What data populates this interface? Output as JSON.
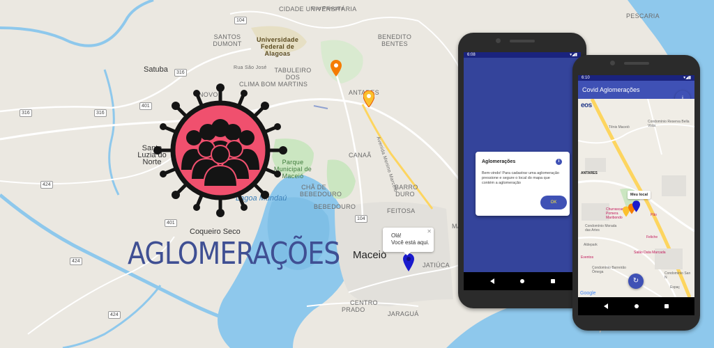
{
  "app": {
    "title": "AGLOMERAÇÕES",
    "colors": {
      "primary": "#3f51b5",
      "logo_red": "#f0506e",
      "logo_outline": "#141414",
      "title_blue": "#3f4f93",
      "accent_yellow": "#ffeb3b"
    }
  },
  "map": {
    "labels": {
      "cidade_universitaria": "CIDADE UNIVERSITÁRIA",
      "santos_dumont": "SANTOS DUMONT",
      "ufal": "Universidade Federal de Alagoas",
      "benedito_bentes": "BENEDITO BENTES",
      "satuba": "Satuba",
      "tabuleiro": "TABULEIRO DOS MARTINS",
      "clima_bom": "CLIMA BOM",
      "novo": "NOVO",
      "santa_luzia": "Santa Luzia do Norte",
      "parque": "Parque Municipal de Maceió",
      "canaa": "CANAÃ",
      "barro_duro": "BARRO DURO",
      "cha_bebedouro": "CHÃ DE BEBEDOURO",
      "bebedouro": "BEBEDOURO",
      "feitosa": "FEITOSA",
      "lagoa": "Lagoa Mundaú",
      "coqueiro_seco": "Coqueiro Seco",
      "maceio": "Maceió",
      "jatiuca": "JATIÚCA",
      "pescaria": "PESCARIA",
      "antares": "ANTARES",
      "prado": "PRADO",
      "centro": "CENTRO",
      "jaragua": "JARAGUÁ",
      "rua_pajucara": "Rua Pajuçara",
      "rua_sao_jose": "Rua São José",
      "avenida": "Avenida Menino Marcelo",
      "ma": "MA"
    },
    "shields": [
      "316",
      "104",
      "401",
      "316",
      "424",
      "401",
      "424",
      "424",
      "104",
      "104",
      "316"
    ],
    "popup": {
      "line1": "Olá!",
      "line2": "Você está aqui.",
      "close": "✕"
    },
    "pins": [
      {
        "name": "orange-pin",
        "color": "#f57c00"
      },
      {
        "name": "yellow-pin",
        "color": "#fbc02d"
      },
      {
        "name": "blue-pin",
        "color": "#1a1acd"
      }
    ]
  },
  "phone1": {
    "status_time": "6:08",
    "status_right": "▾◢▮",
    "dialog": {
      "title": "Aglomerações",
      "info_icon": "i",
      "body": "Bem-vindo! Para cadastrar uma aglomeração pressione e segure o local do mapa que contém a aglomeração",
      "ok_label": "OK"
    }
  },
  "phone2": {
    "status_time": "6:10",
    "status_right": "▾◢▮",
    "appbar_title": "Covid Aglomerações",
    "info_icon": "i",
    "refresh_icon": "↻",
    "map_labels": {
      "eos": "eos",
      "condominio1": "Condomínio Reserva Bella Vista",
      "tenis": "Tênis Maceió",
      "antares": "ANTARES",
      "meu_local": "Meu local",
      "churrascaria": "Churrascaria Pomera Maribondo",
      "pao": "Pão",
      "condominio_artes": "Condomínio Morada das Artes",
      "felicite": "Feliche",
      "aldepark": "Aldepark",
      "salao": "Salão Data Marcada",
      "eventos": "Eventos",
      "condominio_omega": "Condomínio Barreirão Ômega",
      "condominio_san": "Condomínio San N",
      "espac": "Espaç",
      "google": "Google"
    }
  }
}
